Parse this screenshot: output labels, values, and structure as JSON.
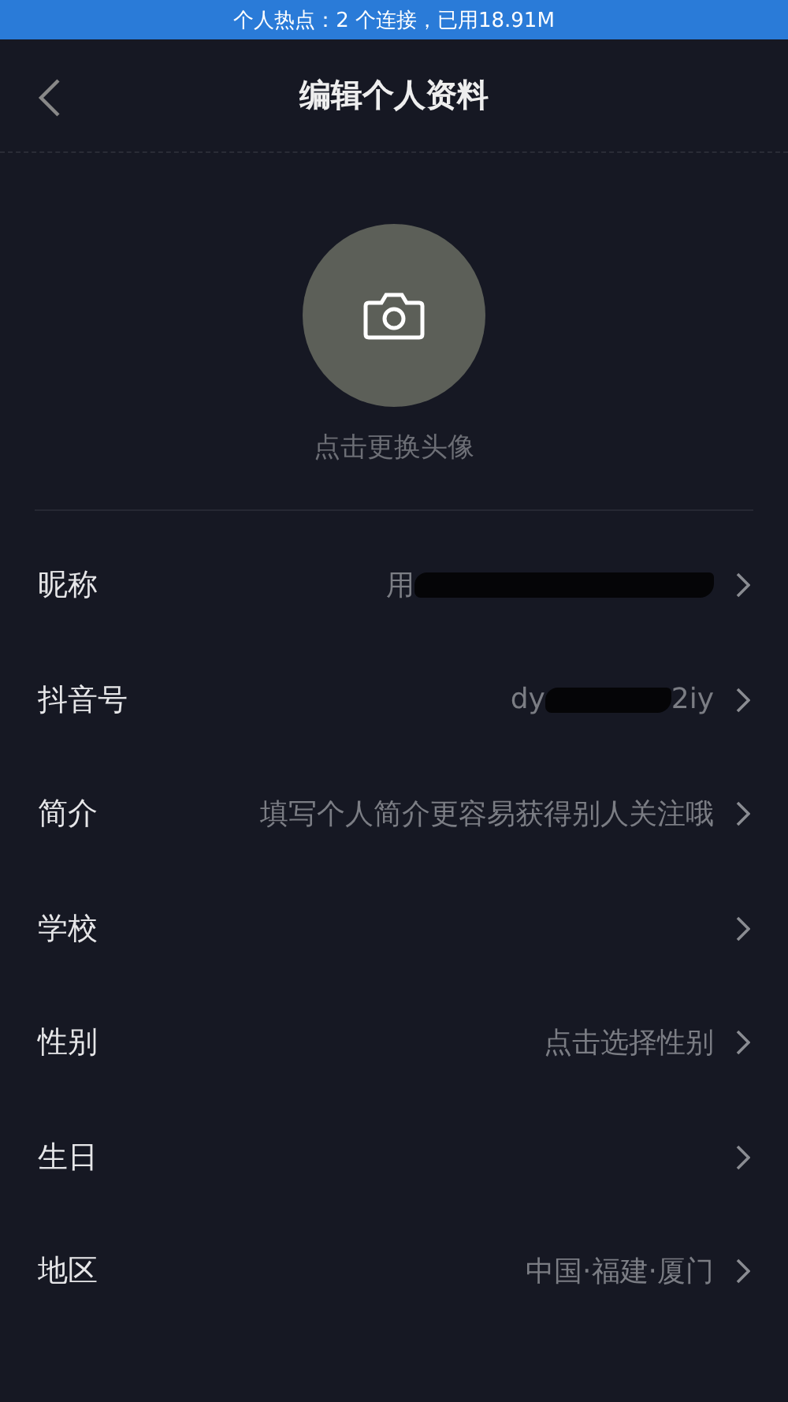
{
  "status_bar": {
    "text": "个人热点：2 个连接，已用18.91M"
  },
  "header": {
    "title": "编辑个人资料"
  },
  "avatar": {
    "caption": "点击更换头像"
  },
  "rows": [
    {
      "label": "昵称",
      "value": "用",
      "redacted": true
    },
    {
      "label": "抖音号",
      "value": "dy",
      "redacted": true,
      "suffix": "2iy"
    },
    {
      "label": "简介",
      "value": "填写个人简介更容易获得别人关注哦",
      "redacted": false
    },
    {
      "label": "学校",
      "redacted": false
    },
    {
      "label": "性别",
      "value": "点击选择性别",
      "redacted": false
    },
    {
      "label": "生日",
      "redacted": false
    },
    {
      "label": "地区",
      "value": "中国·福建·厦门",
      "redacted": false
    }
  ]
}
